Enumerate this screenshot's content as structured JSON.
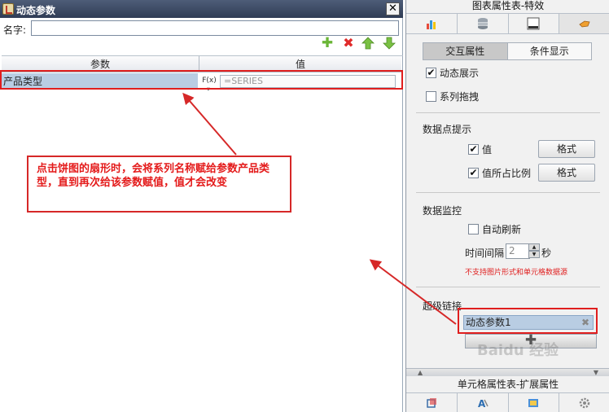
{
  "dialog": {
    "title": "动态参数",
    "close_symbol": "✕",
    "name_label": "名字:",
    "name_value": "",
    "toolbar": {
      "add": "✚",
      "delete": "✖"
    },
    "table": {
      "header_param": "参数",
      "header_value": "值",
      "rows": [
        {
          "name": "产品类型",
          "fx": "F(x)",
          "value": "=SERIES"
        }
      ]
    },
    "annotation": "点击饼图的扇形时，会将系列名称赋给参数产品类型，直到再次给该参数赋值，值才会改变"
  },
  "panel": {
    "title": "图表属性表-特效",
    "segment": {
      "active": "交互属性",
      "inactive": "条件显示"
    },
    "dynamic_display": {
      "label": "动态展示",
      "checked": true
    },
    "series_drag": {
      "label": "系列拖拽",
      "checked": false
    },
    "datapoint_tip": {
      "label": "数据点提示",
      "value": {
        "label": "值",
        "checked": true,
        "button": "格式"
      },
      "percent": {
        "label": "值所占比例",
        "checked": true,
        "button": "格式"
      }
    },
    "monitor": {
      "label": "数据监控",
      "auto_refresh": {
        "label": "自动刷新",
        "checked": false
      },
      "interval_label": "时间间隔",
      "interval_value": "2",
      "interval_unit": "秒",
      "warning": "不支持图片形式和单元格数据源"
    },
    "hyperlink": {
      "label": "超级链接",
      "item": "动态参数1",
      "item_close": "✖",
      "add": "✚"
    },
    "bottom_title": "单元格属性表-扩展属性",
    "check_mark": "✔",
    "watermark": "Baidu 经验"
  },
  "colors": {
    "highlight_red": "#e01e1e",
    "row_selected": "#b9cde3",
    "annotation_text": "#e41a1a"
  }
}
